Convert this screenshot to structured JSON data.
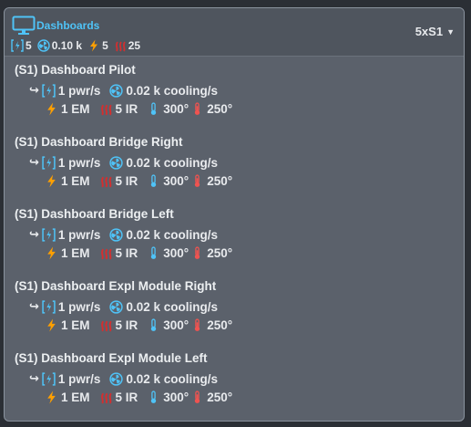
{
  "header": {
    "title": "Dashboards",
    "icon": "monitor-icon",
    "stats": {
      "power": "5",
      "cooling": "0.10 k",
      "em": "5",
      "ir": "25"
    },
    "selector": {
      "label": "5xS1",
      "icon": "caret-down-icon"
    }
  },
  "colors": {
    "title": "#4fc3f7",
    "power_icon": "#4fc3f7",
    "cooling_icon": "#4fc3f7",
    "em_icon": "#ffa000",
    "ir_icon": "#d32f2f",
    "temp_cold": "#4fc3f7",
    "temp_hot": "#ef5350"
  },
  "items": [
    {
      "name": "(S1) Dashboard Pilot",
      "pwr": "1 pwr/s",
      "cooling": "0.02 k cooling/s",
      "em": "1 EM",
      "ir": "5 IR",
      "temp_low": "300°",
      "temp_high": "250°"
    },
    {
      "name": "(S1) Dashboard Bridge Right",
      "pwr": "1 pwr/s",
      "cooling": "0.02 k cooling/s",
      "em": "1 EM",
      "ir": "5 IR",
      "temp_low": "300°",
      "temp_high": "250°"
    },
    {
      "name": "(S1) Dashboard Bridge Left",
      "pwr": "1 pwr/s",
      "cooling": "0.02 k cooling/s",
      "em": "1 EM",
      "ir": "5 IR",
      "temp_low": "300°",
      "temp_high": "250°"
    },
    {
      "name": "(S1) Dashboard Expl Module Right",
      "pwr": "1 pwr/s",
      "cooling": "0.02 k cooling/s",
      "em": "1 EM",
      "ir": "5 IR",
      "temp_low": "300°",
      "temp_high": "250°"
    },
    {
      "name": "(S1) Dashboard Expl Module Left",
      "pwr": "1 pwr/s",
      "cooling": "0.02 k cooling/s",
      "em": "1 EM",
      "ir": "5 IR",
      "temp_low": "300°",
      "temp_high": "250°"
    }
  ]
}
